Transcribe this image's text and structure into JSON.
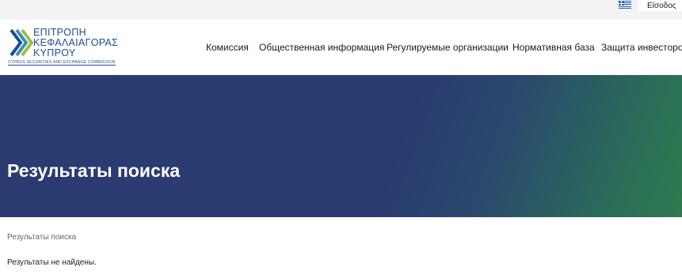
{
  "topbar": {
    "language_flag": "greek-flag-icon",
    "login_label": "Είσοδος"
  },
  "header": {
    "logo": {
      "line1": "ΕΠΙΤΡΟΠΗ",
      "line2": "ΚΕΦΑΛΑΙΑΓΟΡΑΣ",
      "line3": "ΚΥΠΡΟΥ",
      "subtitle": "CYPRUS SECURITIES AND EXCHANGE COMMISSION"
    },
    "nav": [
      {
        "label": "Комиссия"
      },
      {
        "label": "Общественная информация"
      },
      {
        "label": "Регулируемые организации"
      },
      {
        "label": "Нормативная база"
      },
      {
        "label": "Защита инвесторов"
      }
    ]
  },
  "hero": {
    "title": "Результаты поиска"
  },
  "breadcrumb": "Результаты поиска",
  "results_message": "Результаты не найдены.",
  "colors": {
    "brand_blue": "#1f4e8c",
    "hero_blue": "#2a3b72",
    "hero_green": "#2e7a4e"
  }
}
